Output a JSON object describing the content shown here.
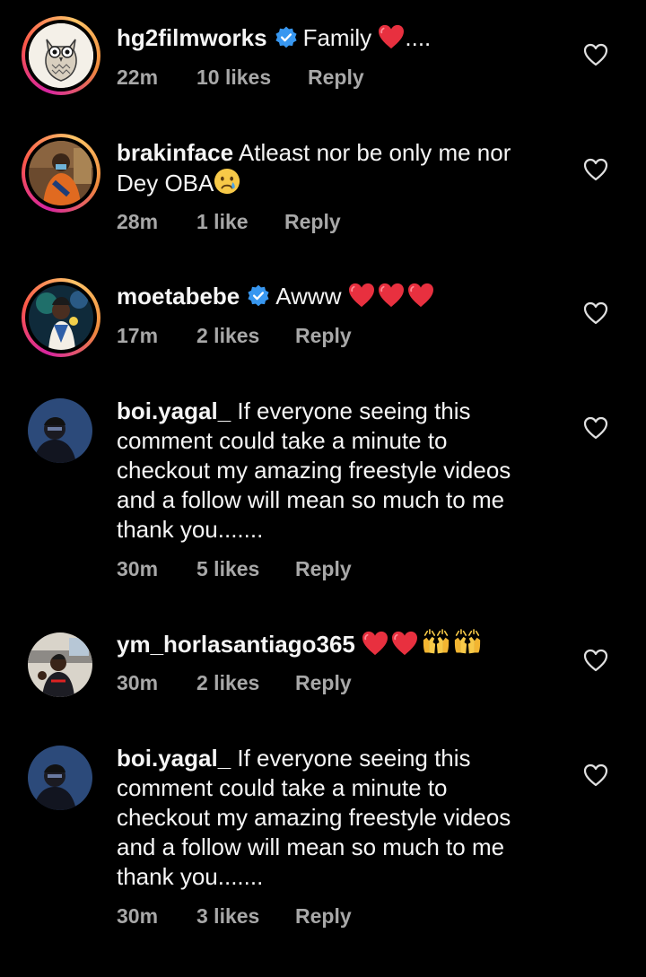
{
  "comments": [
    {
      "username": "hg2filmworks",
      "verified": true,
      "text": "Family",
      "emoji": [
        "heart"
      ],
      "trailing": "....",
      "time": "22m",
      "likes": "10 likes",
      "reply": "Reply",
      "story_ring": true
    },
    {
      "username": "brakinface",
      "verified": false,
      "text_line1": "Atleast nor be only me nor",
      "text_line2": "Dey OBA",
      "emoji": [
        "crying-face"
      ],
      "time": "28m",
      "likes": "1 like",
      "reply": "Reply",
      "story_ring": true
    },
    {
      "username": "moetabebe",
      "verified": true,
      "text": "Awww",
      "emoji": [
        "heart",
        "heart",
        "heart"
      ],
      "time": "17m",
      "likes": "2 likes",
      "reply": "Reply",
      "story_ring": true
    },
    {
      "username": "boi.yagal_",
      "verified": false,
      "text_line1": "If everyone seeing this",
      "text_line2": "comment could take a minute to",
      "text_line3": "checkout my amazing freestyle videos",
      "text_line4": "and a follow will mean so much to me",
      "text_line5": "thank you.......",
      "time": "30m",
      "likes": "5 likes",
      "reply": "Reply",
      "story_ring": false
    },
    {
      "username": "ym_horlasantiago365",
      "verified": false,
      "emoji": [
        "heart",
        "heart",
        "raising-hands",
        "raising-hands"
      ],
      "time": "30m",
      "likes": "2 likes",
      "reply": "Reply",
      "story_ring": false
    },
    {
      "username": "boi.yagal_",
      "verified": false,
      "text_line1": "If everyone seeing this",
      "text_line2": "comment could take a minute to",
      "text_line3": "checkout my amazing freestyle videos",
      "text_line4": "and a follow will mean so much to me",
      "text_line5": "thank you.......",
      "time": "30m",
      "likes": "3 likes",
      "reply": "Reply",
      "story_ring": false
    }
  ],
  "colors": {
    "background": "#000000",
    "text": "#f5f5f5",
    "meta": "#a8a8a8",
    "verified": "#3897f0",
    "heart_emoji": "#e8303f"
  }
}
